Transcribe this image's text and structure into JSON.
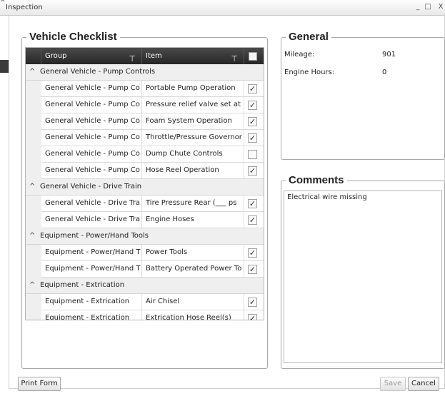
{
  "window": {
    "title": "Inspection",
    "corner_mark": "^",
    "minimize": "_",
    "maximize": "□",
    "close": "X"
  },
  "checklist": {
    "legend": "Vehicle Checklist",
    "columns": {
      "group": "Group",
      "item": "Item"
    },
    "filter_glyph": "⊤",
    "groups": [
      {
        "title": "General Vehicle - Pump Controls",
        "rows": [
          {
            "group": "General Vehicle - Pump Co",
            "item": "Portable Pump Operation",
            "checked": true
          },
          {
            "group": "General Vehicle - Pump Co",
            "item": "Pressure relief valve set at",
            "checked": true
          },
          {
            "group": "General Vehicle - Pump Co",
            "item": "Foam System Operation",
            "checked": true
          },
          {
            "group": "General Vehicle - Pump Co",
            "item": "Throttle/Pressure Governor",
            "checked": true
          },
          {
            "group": "General Vehicle - Pump Co",
            "item": "Dump Chute Controls",
            "checked": false
          },
          {
            "group": "General Vehicle - Pump Co",
            "item": "Hose Reel Operation",
            "checked": true
          }
        ]
      },
      {
        "title": "General Vehicle - Drive Train",
        "rows": [
          {
            "group": "General Vehicle - Drive Tra",
            "item": "Tire Pressure Rear (___ ps",
            "checked": true
          },
          {
            "group": "General Vehicle - Drive Tra",
            "item": "Engine Hoses",
            "checked": true
          }
        ]
      },
      {
        "title": "Equipment - Power/Hand Tools",
        "rows": [
          {
            "group": "Equipment - Power/Hand T",
            "item": "Power Tools",
            "checked": true
          },
          {
            "group": "Equipment - Power/Hand T",
            "item": "Battery Operated Power To",
            "checked": true
          }
        ]
      },
      {
        "title": "Equipment - Extrication",
        "rows": [
          {
            "group": "Equipment - Extrication",
            "item": "Air Chisel",
            "checked": true
          },
          {
            "group": "Equipment - Extrication",
            "item": "Extrication Hose Reel(s)",
            "checked": true
          }
        ]
      }
    ]
  },
  "general": {
    "legend": "General",
    "mileage_label": "Mileage:",
    "mileage_value": "901",
    "engine_hours_label": "Engine Hours:",
    "engine_hours_value": "0"
  },
  "comments": {
    "legend": "Comments",
    "text": "Electrical wire missing"
  },
  "buttons": {
    "print": "Print Form",
    "save": "Save",
    "cancel": "Cancel"
  }
}
